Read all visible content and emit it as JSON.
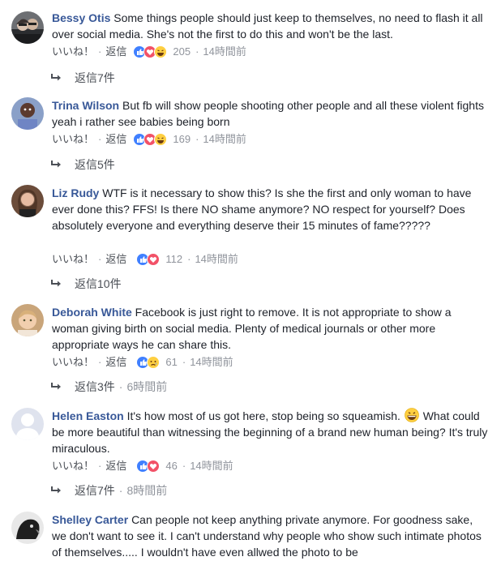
{
  "labels": {
    "like": "いいね！",
    "reply": "返信",
    "separator": "·"
  },
  "colors": {
    "author_link": "#385898",
    "meta_text": "#90949c",
    "like_blue": "#4080ff",
    "love_red": "#f25268",
    "haha_yellow": "#fecf41"
  },
  "comments": [
    {
      "author": "Bessy Otis",
      "text": "Some things people should just keep to themselves, no need to flash it all over social media. She's not the first to do this and won't be the last.",
      "reactions": [
        "like-reaction-icon",
        "love-reaction-icon",
        "haha-reaction-icon"
      ],
      "reaction_count": "205",
      "time": "14時間前",
      "replies_label": "返信7件",
      "replies_time": ""
    },
    {
      "author": "Trina Wilson",
      "text": "But fb will show people shooting other people and all these violent fights yeah i rather see babies being born",
      "reactions": [
        "like-reaction-icon",
        "love-reaction-icon",
        "haha-reaction-icon"
      ],
      "reaction_count": "169",
      "time": "14時間前",
      "replies_label": "返信5件",
      "replies_time": ""
    },
    {
      "author": "Liz Rudy",
      "text": "WTF is it necessary to show this? Is she the first and only woman to have ever done this? FFS! Is there NO shame anymore? NO respect for yourself? Does absolutely everyone and everything deserve their 15 minutes of fame?????",
      "reactions": [
        "like-reaction-icon",
        "love-reaction-icon"
      ],
      "reaction_count": "112",
      "time": "14時間前",
      "replies_label": "返信10件",
      "replies_time": ""
    },
    {
      "author": "Deborah White",
      "text": "Facebook is just right to remove. It is not appropriate to show a woman giving birth on social media. Plenty of medical journals or other more appropriate ways he can share this.",
      "reactions": [
        "like-reaction-icon",
        "sad-reaction-icon"
      ],
      "reaction_count": "61",
      "time": "14時間前",
      "replies_label": "返信3件",
      "replies_time": "6時間前"
    },
    {
      "author": "Helen Easton",
      "text_before_emoji": "It's how most of us got here, stop being so squeamish.",
      "text_after_emoji": "What could be more beautiful than witnessing the beginning of a brand new human being? It's truly miraculous.",
      "inline_emoji": "grinning-emoji-icon",
      "reactions": [
        "like-reaction-icon",
        "love-reaction-icon"
      ],
      "reaction_count": "46",
      "time": "14時間前",
      "replies_label": "返信7件",
      "replies_time": "8時間前"
    },
    {
      "author": "Shelley Carter",
      "text": "Can people not keep anything private anymore. For goodness sake, we don't want to see it. I can't understand why people who show such intimate photos of themselves..... I wouldn't have even allwed the photo to be"
    }
  ]
}
